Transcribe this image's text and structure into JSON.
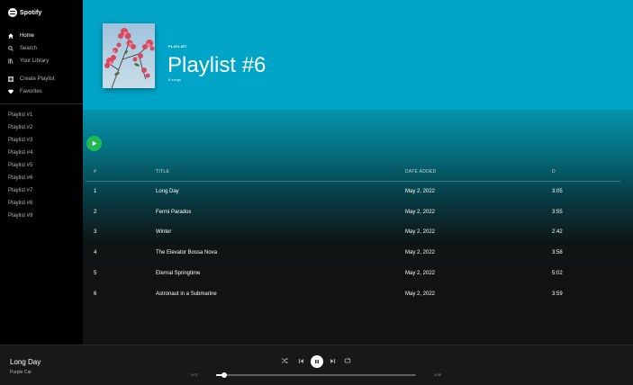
{
  "app": {
    "brand": "Spotify"
  },
  "sidebar": {
    "nav": [
      {
        "label": "Home",
        "icon": "home-icon"
      },
      {
        "label": "Search",
        "icon": "search-icon"
      },
      {
        "label": "Your Library",
        "icon": "library-icon"
      }
    ],
    "actions": [
      {
        "label": "Create Playlist",
        "icon": "plus-icon"
      },
      {
        "label": "Favorites",
        "icon": "heart-icon"
      }
    ],
    "playlists": [
      "Playlist #1",
      "Playlist #2",
      "Playlist #3",
      "Playlist #4",
      "Playlist #5",
      "Playlist #6",
      "Playlist #7",
      "Playlist #8",
      "Playlist #9"
    ]
  },
  "hero": {
    "type": "PLAYLIST",
    "title": "Playlist #6",
    "meta": "6 songs",
    "accent": "#00a4c7"
  },
  "table": {
    "headers": {
      "num": "#",
      "title": "TITLE",
      "date": "DATE ADDED",
      "duration": "D"
    },
    "rows": [
      {
        "num": "1",
        "title": "Long Day",
        "date": "May 2, 2022",
        "duration": "3:05"
      },
      {
        "num": "2",
        "title": "Fermi Paradox",
        "date": "May 2, 2022",
        "duration": "3:55"
      },
      {
        "num": "3",
        "title": "Winter",
        "date": "May 2, 2022",
        "duration": "2:42"
      },
      {
        "num": "4",
        "title": "The Elevator Bossa Nova",
        "date": "May 2, 2022",
        "duration": "3:58"
      },
      {
        "num": "5",
        "title": "Eternal Springtime",
        "date": "May 2, 2022",
        "duration": "5:02"
      },
      {
        "num": "6",
        "title": "Astronaut in a Submarine",
        "date": "May 2, 2022",
        "duration": "3:59"
      }
    ]
  },
  "player": {
    "track": "Long Day",
    "artist": "Purple Cat",
    "elapsed": "0:07",
    "total": "3:05",
    "progress": 0.04,
    "play_color": "#1db954"
  }
}
